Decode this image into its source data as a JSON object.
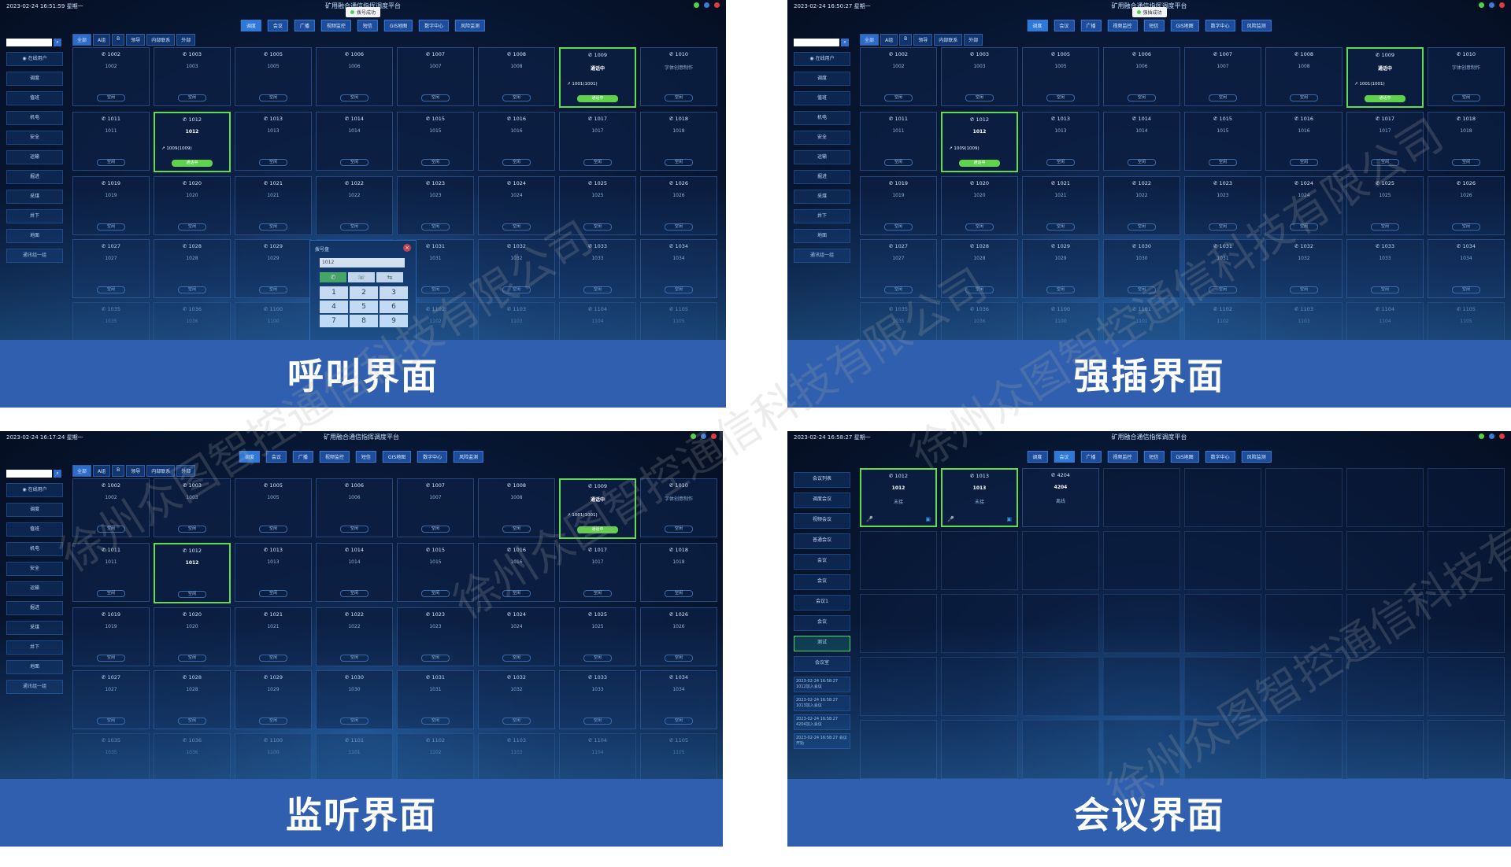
{
  "panels": [
    {
      "label": "呼叫界面",
      "datetime": "2023-02-24 16:51:59 星期一",
      "title": "矿用融合通信指挥调度平台",
      "notice": "拨号成功"
    },
    {
      "label": "强插界面",
      "datetime": "2023-02-24 16:50:27 星期一",
      "title": "矿用融合通信指挥调度平台",
      "notice": "强插成功"
    },
    {
      "label": "监听界面",
      "datetime": "2023-02-24 16:17:24 星期一",
      "title": "矿用融合通信指挥调度平台",
      "notice": ""
    },
    {
      "label": "会议界面",
      "datetime": "2023-02-24 16:58:27 星期一",
      "title": "矿用融合通信指挥调度平台",
      "notice": ""
    }
  ],
  "nav": [
    "调度",
    "会议",
    "广播",
    "视频监控",
    "短信",
    "GIS地图",
    "数字中心",
    "风险监测"
  ],
  "tabs": [
    "全部",
    "A组",
    "B",
    "领导",
    "内部联系",
    "外部"
  ],
  "sidebar": [
    "在线用户",
    "调度",
    "值班",
    "机电",
    "安全",
    "运输",
    "掘进",
    "采煤",
    "井下",
    "地面",
    "通讯组一组"
  ],
  "dialpad": {
    "title": "拨号盘",
    "input": "1012",
    "keys": [
      "1",
      "2",
      "3",
      "4",
      "5",
      "6",
      "7",
      "8",
      "9"
    ]
  },
  "grid": [
    [
      {
        "n": "1002",
        "s": "1002"
      },
      {
        "n": "1003",
        "s": "1003"
      },
      {
        "n": "1005",
        "s": "1005"
      },
      {
        "n": "1006",
        "s": "1006"
      },
      {
        "n": "1007",
        "s": "1007"
      },
      {
        "n": "1008",
        "s": "1008"
      },
      {
        "n": "1009",
        "s": "通话中",
        "active": true,
        "info": "1001(1001)"
      },
      {
        "n": "1010",
        "s": "字体创意制作"
      }
    ],
    [
      {
        "n": "1011",
        "s": "1011"
      },
      {
        "n": "1012",
        "s": "1012",
        "active": true,
        "info": "1009(1009)"
      },
      {
        "n": "1013",
        "s": "1013"
      },
      {
        "n": "1014",
        "s": "1014"
      },
      {
        "n": "1015",
        "s": "1015"
      },
      {
        "n": "1016",
        "s": "1016"
      },
      {
        "n": "1017",
        "s": "1017"
      },
      {
        "n": "1018",
        "s": "1018"
      }
    ],
    [
      {
        "n": "1019",
        "s": "1019"
      },
      {
        "n": "1020",
        "s": "1020"
      },
      {
        "n": "1021",
        "s": "1021"
      },
      {
        "n": "1022",
        "s": "1022"
      },
      {
        "n": "1023",
        "s": "1023"
      },
      {
        "n": "1024",
        "s": "1024"
      },
      {
        "n": "1025",
        "s": "1025"
      },
      {
        "n": "1026",
        "s": "1026"
      }
    ],
    [
      {
        "n": "1027",
        "s": "1027"
      },
      {
        "n": "1028",
        "s": "1028"
      },
      {
        "n": "1029",
        "s": "1029"
      },
      {
        "n": "1030",
        "s": "1030"
      },
      {
        "n": "1031",
        "s": "1031"
      },
      {
        "n": "1032",
        "s": "1032"
      },
      {
        "n": "1033",
        "s": "1033"
      },
      {
        "n": "1034",
        "s": "1034"
      }
    ],
    [
      {
        "n": "1035",
        "s": "1035"
      },
      {
        "n": "1036",
        "s": "1036"
      },
      {
        "n": "1100",
        "s": "1100"
      },
      {
        "n": "1101",
        "s": "1101"
      },
      {
        "n": "1102",
        "s": "1102"
      },
      {
        "n": "1103",
        "s": "1103"
      },
      {
        "n": "1104",
        "s": "1104"
      },
      {
        "n": "1105",
        "s": "1105"
      }
    ]
  ],
  "btn_idle": "空闲",
  "btn_talk": "通话中",
  "conference": {
    "cells": [
      {
        "n": "1012",
        "s": "1012",
        "st": "未接"
      },
      {
        "n": "1013",
        "s": "1013",
        "st": "未接"
      },
      {
        "n": "4204",
        "s": "4204",
        "st": "离线"
      }
    ],
    "sidebar": [
      "会议列表",
      "调度会议",
      "视频会议",
      "普通会议",
      "会议",
      "会议",
      "会议1",
      "会议",
      "测试",
      "会议室"
    ],
    "logs": [
      "2023-02-24 16:58:27 1012加入会议",
      "2023-02-24 16:58:27 1013加入会议",
      "2023-02-24 16:58:27 4204加入会议",
      "2023-02-24 16:58:27 会议开始"
    ]
  },
  "watermark": "徐州众图智控通信科技有限公司",
  "colors": {
    "label_bg": "#2f5fae",
    "active_border": "#5fdc52",
    "screen_bg": "#071631"
  }
}
